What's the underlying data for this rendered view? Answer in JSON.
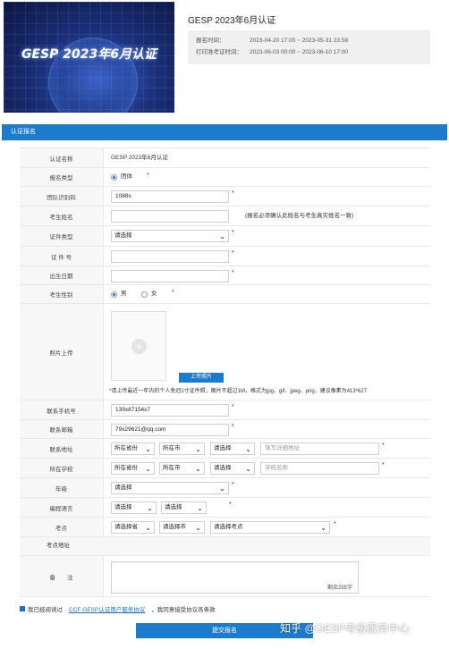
{
  "banner": {
    "title": "GESP 2023年6月认证"
  },
  "header": {
    "title": "GESP 2023年6月认证",
    "info": [
      {
        "label": "报名时间：",
        "value": "2023-04-20 17:00 ~ 2023-05-31 23:59"
      },
      {
        "label": "打印准考证时间：",
        "value": "2023-06-03 00:00 ~ 2023-06-10 17:00"
      }
    ]
  },
  "section": {
    "title": "认证报名"
  },
  "form": {
    "cert_name": {
      "label": "认证名称",
      "value": "GESP 2023年6月认证"
    },
    "reg_type": {
      "label": "报名类型",
      "option": "团体"
    },
    "group_code": {
      "label": "团队识别码",
      "value": "1088s"
    },
    "name": {
      "label": "考生姓名",
      "hint": "(报名必须确认此姓名与考生真实姓名一致)"
    },
    "id_type": {
      "label": "证件类型",
      "value": "请选择"
    },
    "id_no": {
      "label": "证 件 号"
    },
    "birth": {
      "label": "出生日期"
    },
    "gender": {
      "label": "考生性别",
      "male": "男",
      "female": "女"
    },
    "photo": {
      "label": "照片上传",
      "button": "上传照片",
      "note": "*请上传最近一年内的个人免冠1寸证件照，图片不超过1M，格式为jpg、gif、jpeg、png，建议像素为413*627"
    },
    "phone": {
      "label": "联系手机号",
      "value": "139x87154x7"
    },
    "email": {
      "label": "联系邮箱",
      "value": "79x29621@qq.com"
    },
    "address": {
      "label": "联系地址",
      "province": "所在省份",
      "city": "所在市",
      "district": "请选择",
      "placeholder": "填写详细地址"
    },
    "school": {
      "label": "所在学校",
      "province": "所在省份",
      "city": "所在市",
      "district": "请选择",
      "placeholder": "学校名称"
    },
    "grade": {
      "label": "年级",
      "value": "请选择"
    },
    "language": {
      "label": "编程语言",
      "lang": "请选择",
      "level": "请选择"
    },
    "exam_site": {
      "label": "考点",
      "province": "请选择省",
      "city": "请选择市",
      "site": "请选择考点"
    },
    "site_address": {
      "label": "考点地址"
    },
    "remark": {
      "label": "备　　注",
      "counter": "剩余255字"
    }
  },
  "agreement": {
    "prefix": "我已经阅读过",
    "link": "CCF GESP认证用户服务协议",
    "suffix": "，我同意接受协议各条款"
  },
  "submit_label": "提交报名",
  "watermark": "知乎 @GESP考级服务中心",
  "colors": {
    "accent": "#1c7ccb",
    "required": "#dd0000"
  }
}
